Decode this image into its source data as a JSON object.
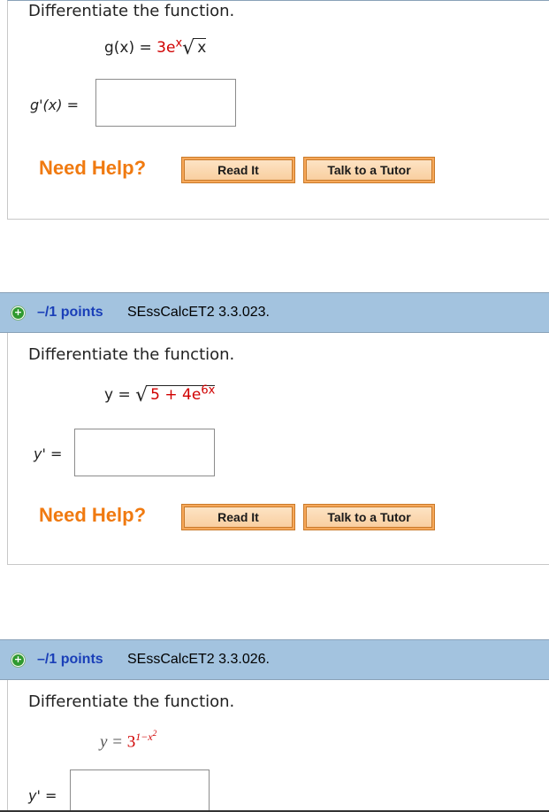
{
  "top_border_color": "#8aa2b8",
  "q1": {
    "instruction": "Differentiate the function.",
    "eq_lhs": "g(x) = ",
    "eq_coef": "3e",
    "eq_exp": "x",
    "eq_rad": "x",
    "answer_label": "g'(x) =",
    "need_help": "Need Help?",
    "read_it": "Read It",
    "tutor": "Talk to a Tutor"
  },
  "q2": {
    "expand_icon": "plus-circle-icon",
    "points": "–/1 points",
    "code": "SEssCalcET2 3.3.023.",
    "instruction": "Differentiate the function.",
    "eq_lhs": "y = ",
    "eq_rad_a": "5 + 4e",
    "eq_rad_exp": "6x",
    "answer_label": "y' =",
    "need_help": "Need Help?",
    "read_it": "Read It",
    "tutor": "Talk to a Tutor"
  },
  "q3": {
    "expand_icon": "plus-circle-icon",
    "points": "–/1 points",
    "code": "SEssCalcET2 3.3.026.",
    "instruction": "Differentiate the function.",
    "eq_lhs": "y = ",
    "eq_base": "3",
    "eq_exp": "1−x",
    "eq_exp_sq": "2",
    "answer_label": "y' ="
  },
  "colors": {
    "accent_red": "#d00000",
    "help_orange": "#f07a10",
    "points_blue": "#1a3fb8",
    "bar_blue": "#a3c3df"
  }
}
